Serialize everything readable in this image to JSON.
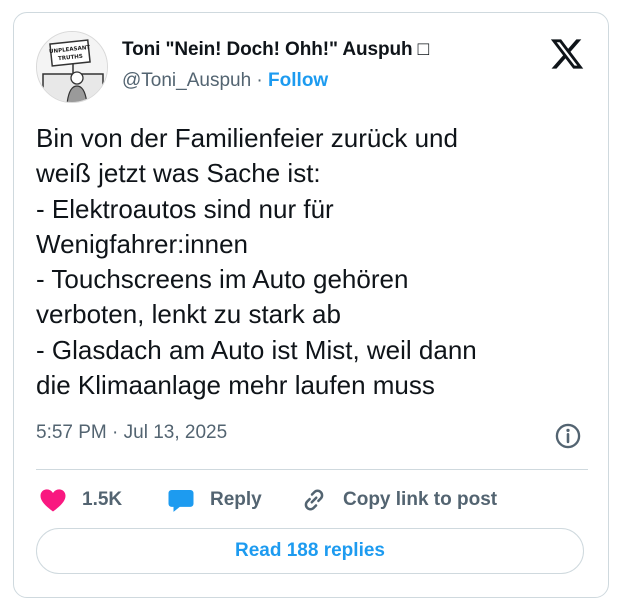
{
  "author": {
    "name": "Toni \"Nein! Doch! Ohh!\" Auspuh □",
    "handle": "@Toni_Auspuh",
    "separator": " · ",
    "follow_label": "Follow",
    "avatar_sign_text": "UNPLEASANT TRUTHS"
  },
  "tweet": {
    "lines": [
      "Bin von der Familienfeier zurück und",
      "weiß jetzt was Sache ist:",
      "- Elektroautos sind nur für",
      "Wenigfahrer:innen",
      "- Touchscreens im Auto gehören",
      "verboten, lenkt zu stark ab",
      "- Glasdach am Auto ist Mist, weil dann",
      "die Klimaanlage mehr laufen muss"
    ],
    "timestamp": "5:57 PM · Jul 13, 2025"
  },
  "actions": {
    "like_count": "1.5K",
    "reply_label": "Reply",
    "copy_link_label": "Copy link to post"
  },
  "read_replies_label": "Read 188 replies",
  "colors": {
    "accent": "#1d9bf0",
    "like": "#f91880",
    "muted": "#536471",
    "border": "#cfd9de"
  },
  "icons": {
    "brand": "x-logo-icon",
    "info": "info-icon",
    "like": "heart-icon",
    "reply": "speech-bubble-icon",
    "copy_link": "link-icon"
  }
}
